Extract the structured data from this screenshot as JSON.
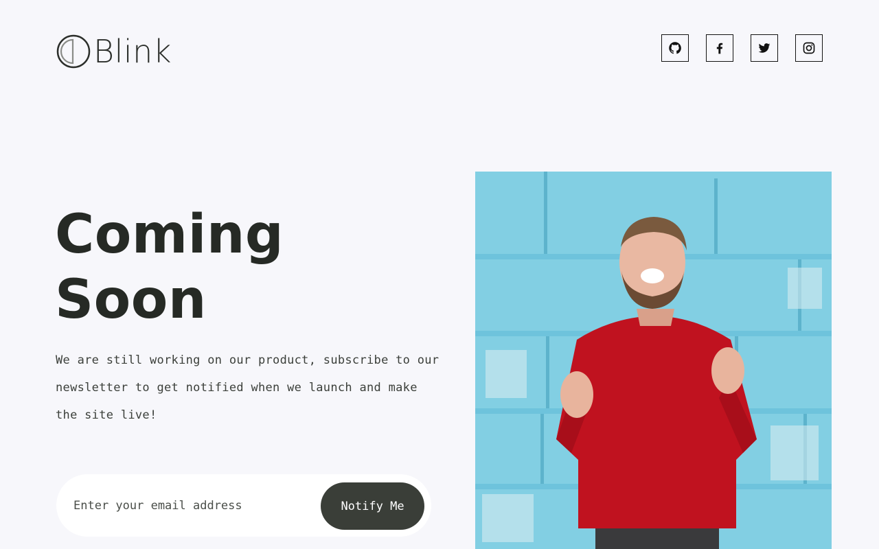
{
  "brand": {
    "name": "Blink"
  },
  "socials": [
    {
      "label": "GitHub",
      "icon": "github-icon"
    },
    {
      "label": "Facebook",
      "icon": "facebook-icon"
    },
    {
      "label": "Twitter",
      "icon": "twitter-icon"
    },
    {
      "label": "Instagram",
      "icon": "instagram-icon"
    }
  ],
  "hero": {
    "title_line1": "Coming",
    "title_line2": "Soon",
    "description": "We are still working on our product, subscribe to our newsletter to get notified when we launch and make the site live!"
  },
  "subscribe": {
    "placeholder": "Enter your email address",
    "value": "",
    "button_label": "Notify Me"
  },
  "colors": {
    "background": "#f7f7fb",
    "text": "#262a25",
    "button": "#3a3e38",
    "photo_wall": "#7dcbe0",
    "sweater": "#c0121f"
  }
}
